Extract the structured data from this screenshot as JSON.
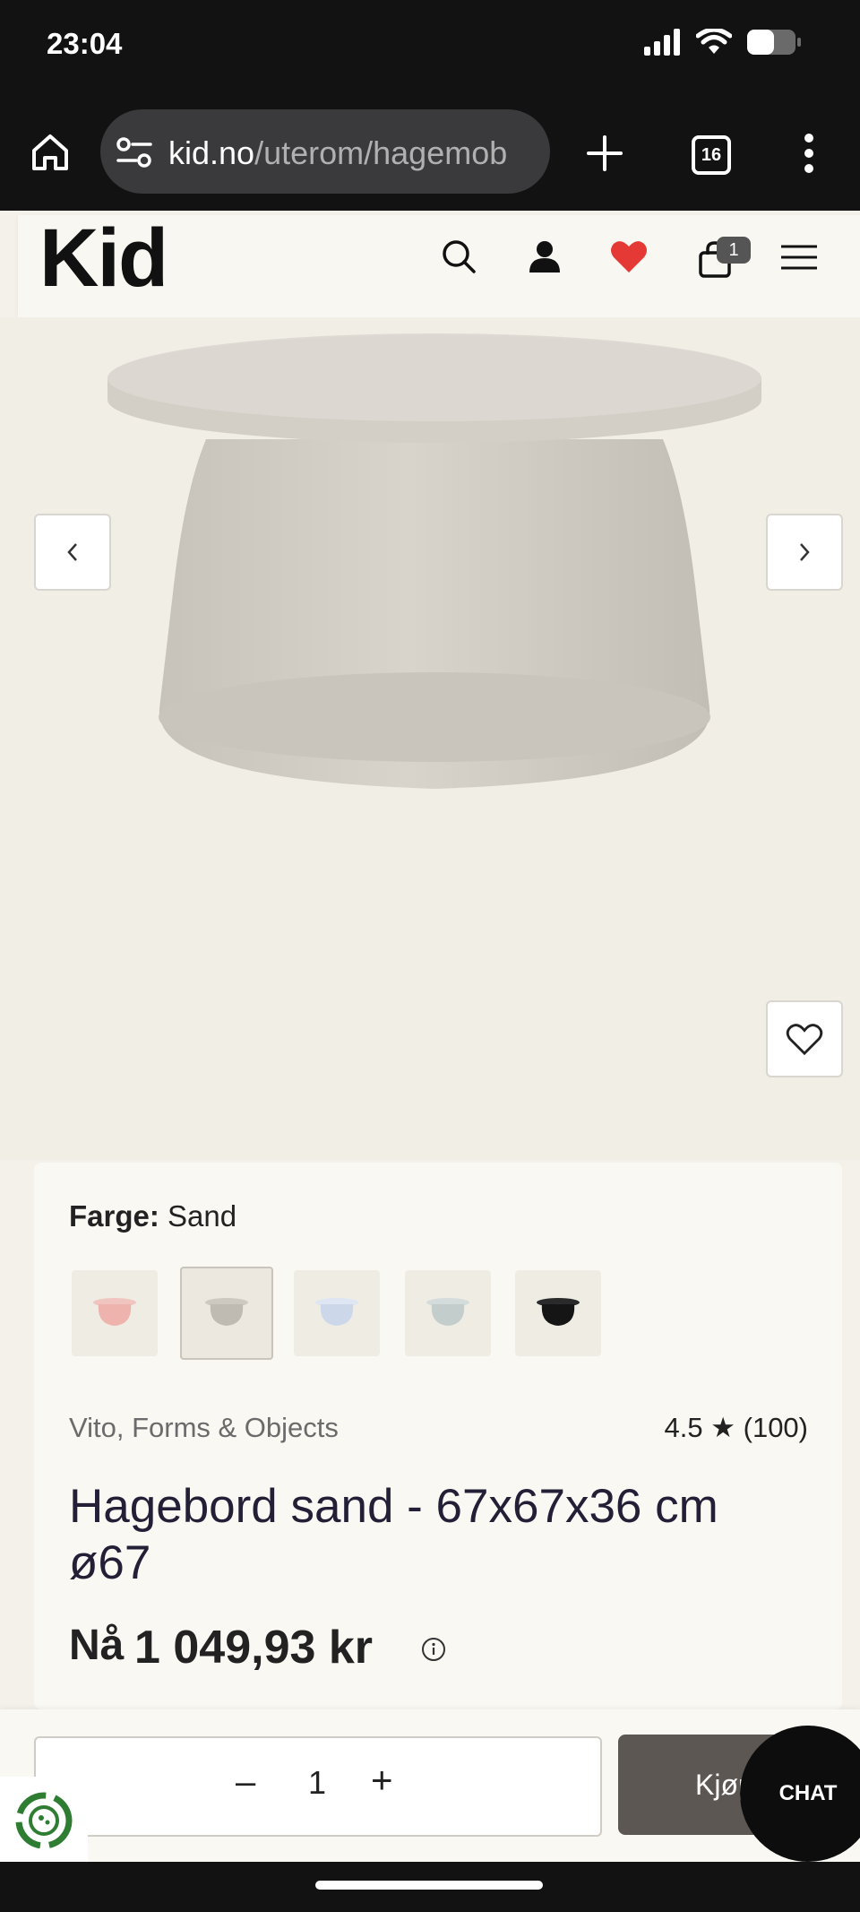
{
  "status": {
    "time": "23:04"
  },
  "browser": {
    "url_domain": "kid.no",
    "url_path": "/uterom/hagemob",
    "tab_count": "16"
  },
  "header": {
    "logo": "Kid",
    "cart_count": "1"
  },
  "product": {
    "color_label": "Farge:",
    "color_value": "Sand",
    "swatches": [
      "rosa",
      "sand",
      "lys blå",
      "grå",
      "svart"
    ],
    "brand": "Vito, Forms & Objects",
    "rating": "4.5 ★ (100)",
    "title": "Hagebord sand - 67x67x36 cm ø67",
    "price_label": "Nå",
    "price": "1 049,93 kr"
  },
  "cart_bar": {
    "quantity": "1",
    "buy_label": "Kjøp",
    "chat_label": "CHAT"
  },
  "colors": {
    "brand_heart": "#e53935",
    "buy_button": "#5d5753",
    "page_bg": "#f4f1ea"
  }
}
